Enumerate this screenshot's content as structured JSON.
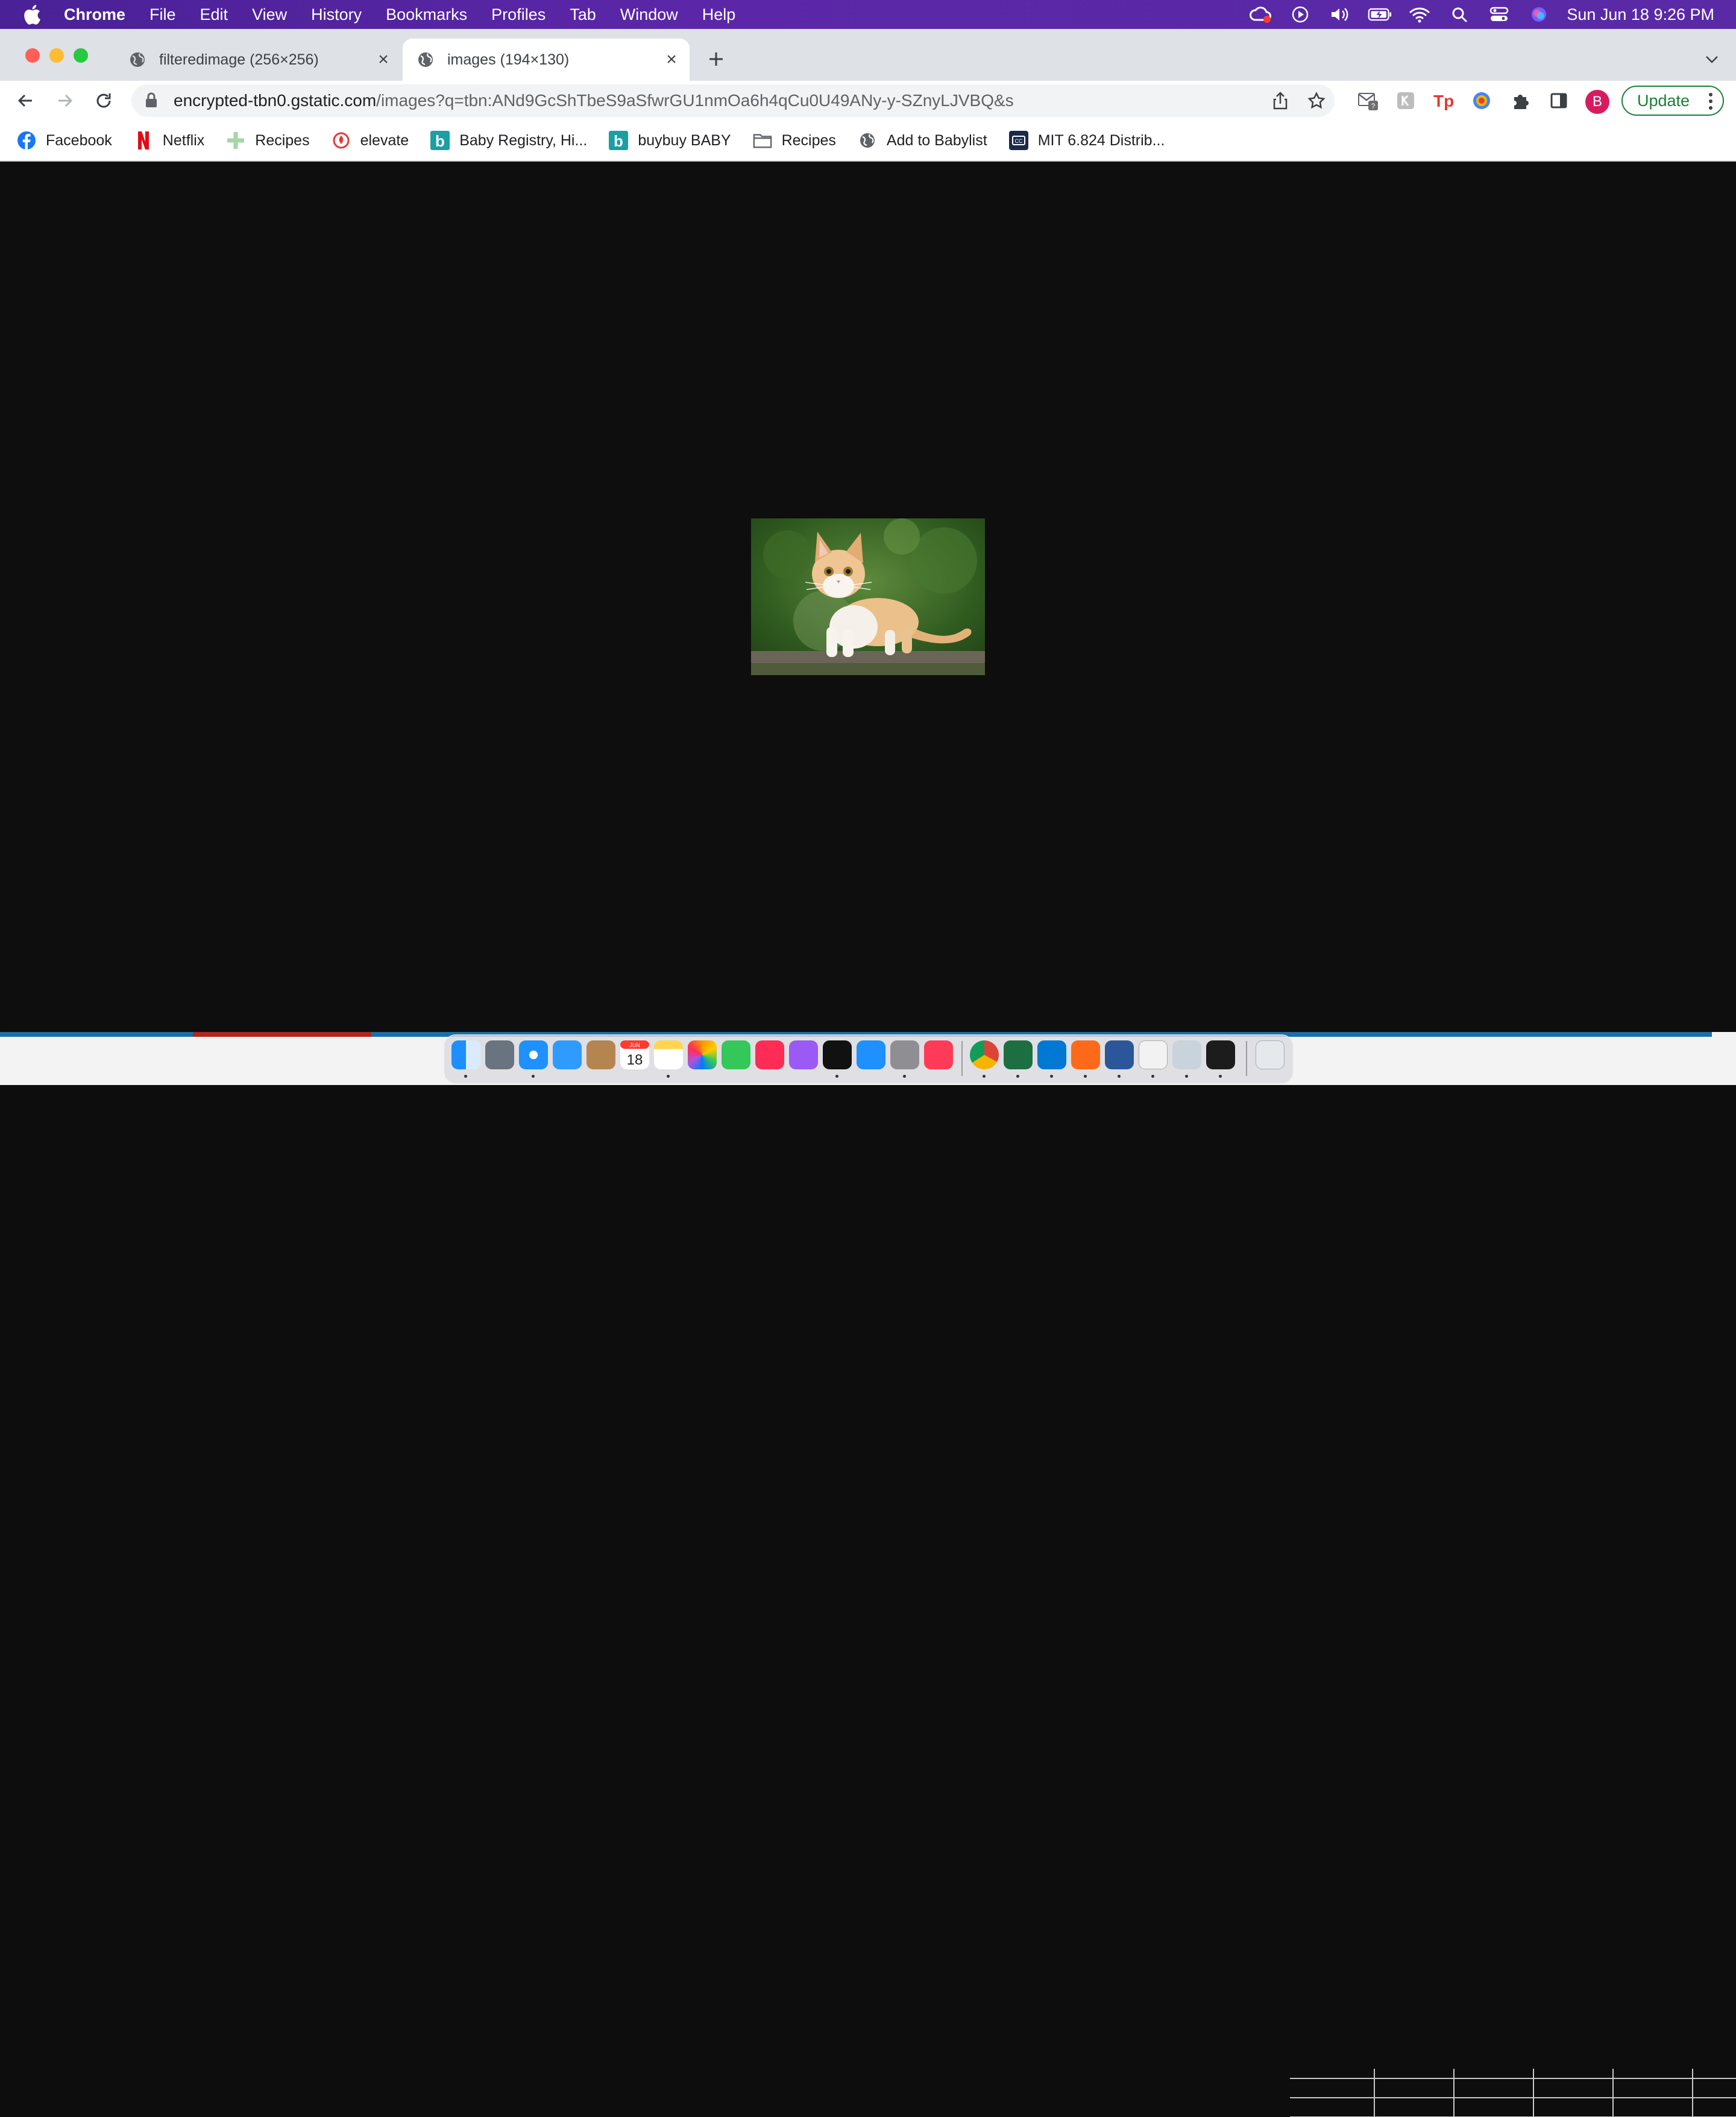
{
  "menubar": {
    "app_name": "Chrome",
    "items": [
      "File",
      "Edit",
      "View",
      "History",
      "Bookmarks",
      "Profiles",
      "Tab",
      "Window",
      "Help"
    ],
    "clock": "Sun Jun 18  9:26 PM"
  },
  "tabs": [
    {
      "title": "filteredimage (256×256)",
      "active": false
    },
    {
      "title": "images (194×130)",
      "active": true
    }
  ],
  "omnibox": {
    "host": "encrypted-tbn0.gstatic.com",
    "path": "/images?q=tbn:ANd9GcShTbeS9aSfwrGU1nmOa6h4qCu0U49ANy-y-SZnyLJVBQ&s"
  },
  "profile": {
    "initial": "B"
  },
  "update_button": {
    "label": "Update"
  },
  "bookmarks": [
    {
      "label": "Facebook",
      "icon": "facebook-icon"
    },
    {
      "label": "Netflix",
      "icon": "netflix-icon"
    },
    {
      "label": "Recipes",
      "icon": "plus-icon"
    },
    {
      "label": "elevate",
      "icon": "elevate-icon"
    },
    {
      "label": "Baby Registry, Hi...",
      "icon": "buybuy-icon"
    },
    {
      "label": "buybuy BABY",
      "icon": "buybuy-icon"
    },
    {
      "label": "Recipes",
      "icon": "folder-icon"
    },
    {
      "label": "Add to Babylist",
      "icon": "globe-icon"
    },
    {
      "label": "MIT 6.824 Distrib...",
      "icon": "cc-icon"
    }
  ],
  "image": {
    "description_icon": "kitten-photo"
  },
  "dock": {
    "calendar_day": "18",
    "calendar_month": "JUN",
    "apps": [
      "finder",
      "launchpad",
      "safari",
      "mail",
      "contacts",
      "calendar",
      "notes",
      "photos",
      "facetime",
      "music",
      "podcasts",
      "tv",
      "app-store",
      "system-preferences",
      "news",
      "chrome",
      "excel",
      "vscode",
      "sublime",
      "word",
      "textedit",
      "downloads",
      "terminal",
      "trash"
    ]
  },
  "colors": {
    "menubar": "#5b27a8",
    "update_green": "#188038",
    "profile_pink": "#d81b60"
  }
}
